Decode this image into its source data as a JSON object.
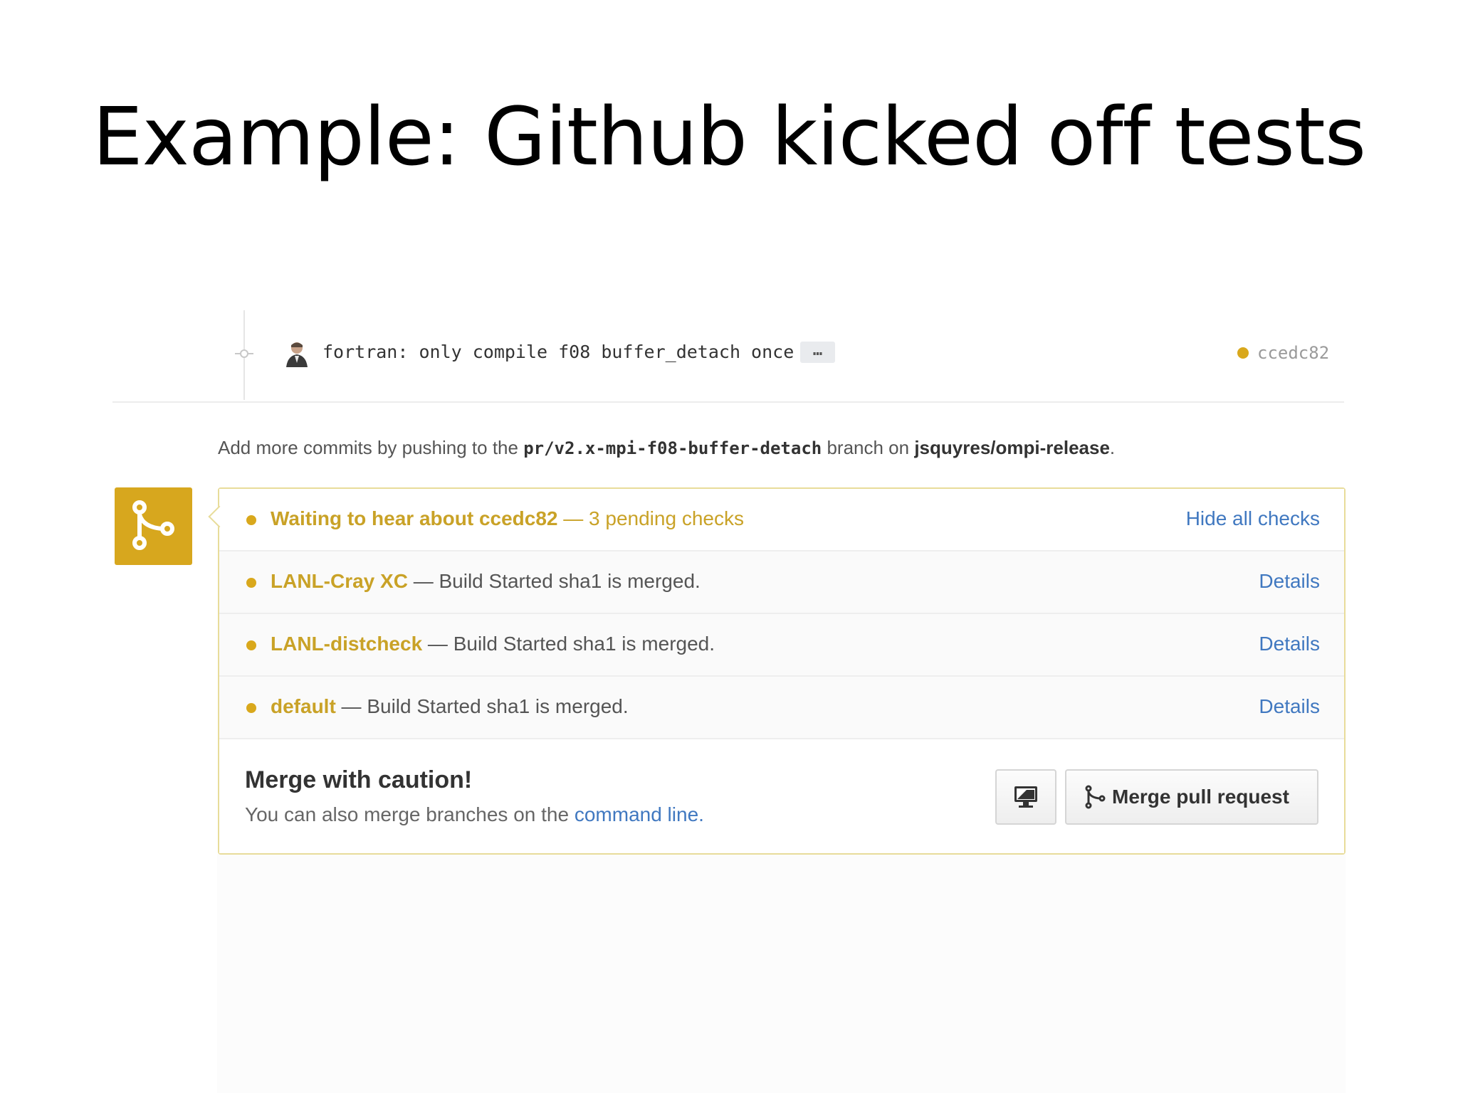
{
  "slide": {
    "title": "Example: Github kicked off tests"
  },
  "commit": {
    "message": "fortran: only compile f08 buffer_detach once",
    "ellipsis": "…",
    "sha": "ccedc82",
    "status_color": "#d9a81c"
  },
  "help": {
    "prefix": "Add more commits by pushing to the ",
    "branch": "pr/v2.x-mpi-f08-buffer-detach",
    "middle": " branch on ",
    "repo": "jsquyres/ompi-release",
    "suffix": "."
  },
  "checks": {
    "summary": {
      "title": "Waiting to hear about ccedc82",
      "pending": " — 3 pending checks",
      "toggle_label": "Hide all checks"
    },
    "items": [
      {
        "context": "LANL-Cray XC",
        "description": " — Build Started sha1 is merged.",
        "link": "Details"
      },
      {
        "context": "LANL-distcheck",
        "description": " — Build Started sha1 is merged.",
        "link": "Details"
      },
      {
        "context": "default",
        "description": " — Build Started sha1 is merged.",
        "link": "Details"
      }
    ]
  },
  "merge": {
    "title": "Merge with caution!",
    "sub_prefix": "You can also merge branches on the ",
    "sub_link": "command line",
    "sub_suffix": ".",
    "button_label": "Merge pull request"
  },
  "colors": {
    "accent": "#d7a71e",
    "link": "#4078c0"
  },
  "icons": {
    "badge": "git-merge-icon",
    "commit": "git-commit-icon",
    "monitor": "desktop-icon",
    "merge_button": "git-merge-icon"
  }
}
